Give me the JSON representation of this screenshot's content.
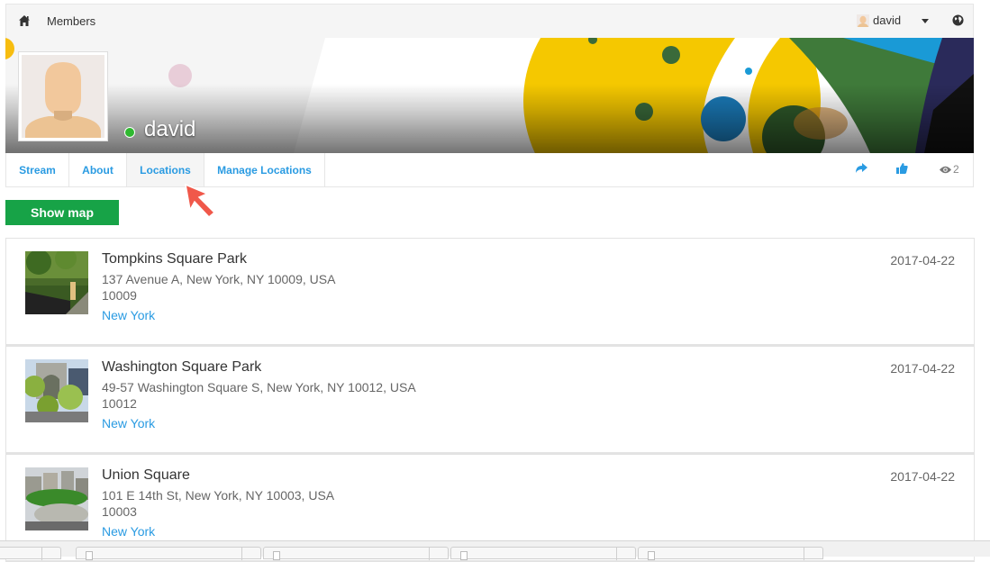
{
  "topbar": {
    "home_icon": "home-icon",
    "breadcrumb": "Members",
    "user_name": "david",
    "user_menu_icon": "caret-down-icon",
    "language_icon": "globe-icon"
  },
  "profile": {
    "name": "david",
    "status": "online",
    "status_color": "#2fb830"
  },
  "tabs": [
    {
      "label": "Stream",
      "active": false
    },
    {
      "label": "About",
      "active": false
    },
    {
      "label": "Locations",
      "active": true
    },
    {
      "label": "Manage Locations",
      "active": false
    }
  ],
  "actions": {
    "share_icon": "share-icon",
    "like_icon": "thumbs-up-icon",
    "views_icon": "eye-icon",
    "views_count": "2"
  },
  "show_map_label": "Show map",
  "locations": [
    {
      "title": "Tompkins Square Park",
      "address": "137 Avenue A, New York, NY 10009, USA",
      "zip": "10009",
      "city": "New York",
      "date": "2017-04-22"
    },
    {
      "title": "Washington Square Park",
      "address": "49-57 Washington Square S, New York, NY 10012, USA",
      "zip": "10012",
      "city": "New York",
      "date": "2017-04-22"
    },
    {
      "title": "Union Square",
      "address": "101 E 14th St, New York, NY 10003, USA",
      "zip": "10003",
      "city": "New York",
      "date": "2017-04-22"
    }
  ],
  "colors": {
    "link": "#2a9be2",
    "button": "#17a347",
    "annotation_arrow": "#f0584a"
  }
}
